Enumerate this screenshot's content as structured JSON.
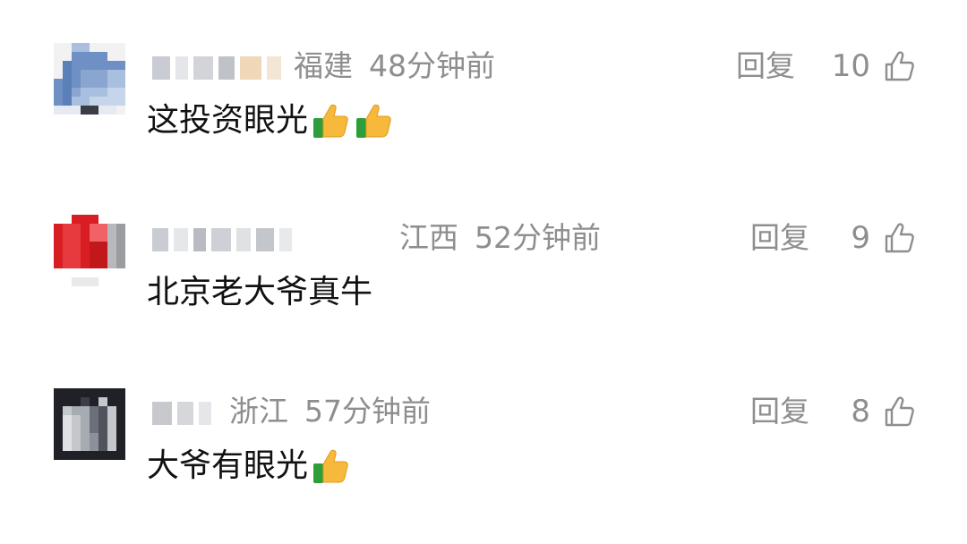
{
  "comments": [
    {
      "username_hidden": true,
      "location": "福建",
      "time": "48分钟前",
      "reply_label": "回复",
      "like_count": "10",
      "text": "这投资眼光",
      "emoji": "thumbs-up-icon",
      "emoji_count": 2
    },
    {
      "username_hidden": true,
      "location": "江西",
      "time": "52分钟前",
      "reply_label": "回复",
      "like_count": "9",
      "text": "北京老大爷真牛",
      "emoji": "",
      "emoji_count": 0
    },
    {
      "username_hidden": true,
      "location": "浙江",
      "time": "57分钟前",
      "reply_label": "回复",
      "like_count": "8",
      "text": "大爷有眼光",
      "emoji": "thumbs-up-icon",
      "emoji_count": 1
    }
  ],
  "colors": {
    "meta_text": "#8e8e8e",
    "body_text": "#111111",
    "emoji_thumb": "#f6b93b",
    "emoji_cuff": "#2e9e3a"
  }
}
